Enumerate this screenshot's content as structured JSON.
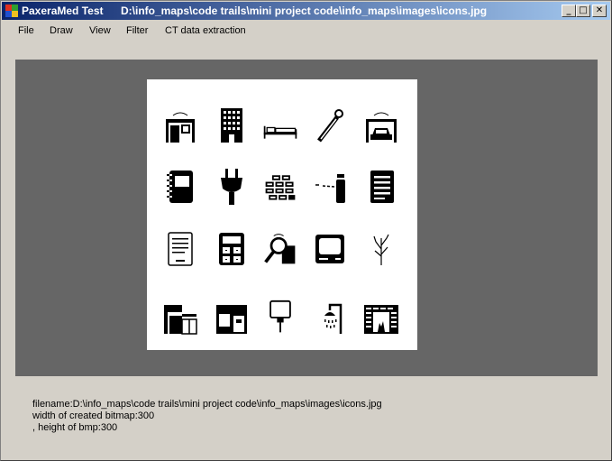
{
  "window": {
    "app_title": "PaxeraMed Test",
    "file_path": "D:\\info_maps\\code trails\\mini project code\\info_maps\\images\\icons.jpg",
    "controls": {
      "minimize": "_",
      "maximize": "□",
      "close": "✕"
    }
  },
  "menu": {
    "file": "File",
    "draw": "Draw",
    "view": "View",
    "filter": "Filter",
    "ct": "CT data extraction"
  },
  "colors": {
    "title_start": "#0a246a",
    "title_end": "#a6caf0",
    "panel": "#666666",
    "face": "#d4d0c8"
  },
  "image": {
    "icons": [
      "house-icon",
      "building-icon",
      "bed-icon",
      "thermometer-icon",
      "garage-car-icon",
      "notebook-icon",
      "plug-icon",
      "bricks-icon",
      "lamp-icon",
      "document-icon",
      "page-icon",
      "calculator-icon",
      "magnifier-icon",
      "television-icon",
      "plant-icon",
      "kitchen-icon",
      "stove-counter-icon",
      "sign-icon",
      "shower-icon",
      "fireplace-icon"
    ]
  },
  "info": {
    "filename_line": "filename:D:\\info_maps\\code trails\\mini project code\\info_maps\\images\\icons.jpg",
    "width_line": "width of created bitmap:300",
    "height_line": ", height of bmp:300"
  }
}
